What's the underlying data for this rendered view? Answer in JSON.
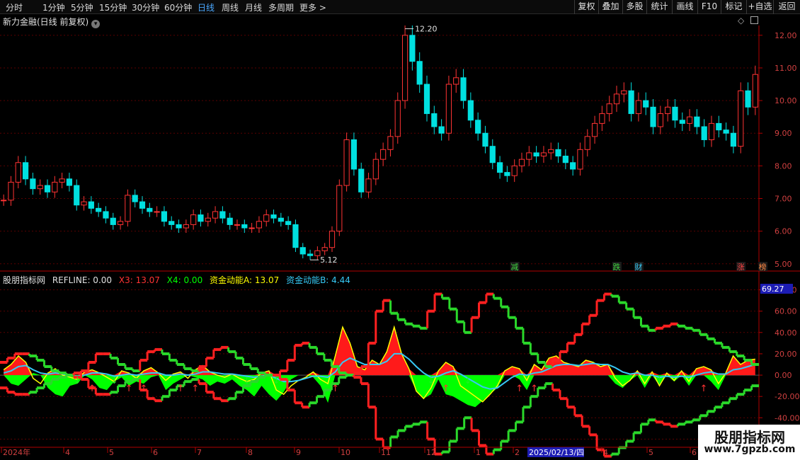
{
  "toolbar": {
    "timeframes": [
      "分时",
      "1分钟",
      "5分钟",
      "15分钟",
      "30分钟",
      "60分钟",
      "日线",
      "周线",
      "月线",
      "多周期",
      "更多 >"
    ],
    "active_timeframe": "日线",
    "buttons": [
      "复权",
      "叠加",
      "多股",
      "统计",
      "画线",
      "F10",
      "标记",
      "+自选",
      "返回"
    ]
  },
  "kline_title": "新力金融(日线 前复权)",
  "ind_title": {
    "name": "股朋指标网",
    "refline": "REFLINE: 0.00",
    "x3": "X3: 13.07",
    "x4": "X4: 0.00",
    "a": "资金动能A: 13.07",
    "b": "资金动能B: 4.44"
  },
  "logo": {
    "line1": "股朋指标网",
    "line2": "www.7gpzb.com"
  },
  "colors": {
    "up": "#ff3333",
    "down": "#00e0e0",
    "green": "#00ff00",
    "yellow": "#ffff00",
    "cyan": "#36c9f5",
    "axis": "#b00000"
  },
  "chart_data": [
    {
      "type": "candlestick",
      "title": "新力金融(日线 前复权)",
      "y_ticks": [
        5.0,
        6.0,
        7.0,
        8.0,
        9.0,
        10.0,
        11.0,
        12.0
      ],
      "ylim": [
        4.8,
        12.3
      ],
      "high_label": "12.20",
      "low_label": "5.12",
      "closes": [
        6.95,
        7.5,
        8.1,
        7.6,
        7.3,
        7.4,
        7.2,
        7.5,
        7.6,
        7.4,
        6.8,
        6.9,
        6.7,
        6.6,
        6.4,
        6.2,
        6.3,
        7.1,
        6.9,
        6.7,
        6.6,
        6.6,
        6.3,
        6.2,
        6.1,
        6.2,
        6.5,
        6.3,
        6.4,
        6.6,
        6.4,
        6.2,
        6.2,
        6.1,
        6.1,
        6.3,
        6.5,
        6.4,
        6.3,
        6.2,
        5.5,
        5.3,
        5.25,
        5.4,
        5.5,
        6.0,
        7.4,
        8.8,
        7.9,
        7.2,
        7.6,
        8.2,
        8.5,
        8.9,
        10.0,
        12.0,
        11.2,
        10.5,
        9.6,
        9.2,
        9.0,
        10.5,
        10.7,
        10.0,
        9.4,
        9.0,
        8.6,
        8.1,
        7.8,
        7.7,
        8.0,
        8.2,
        8.4,
        8.3,
        8.4,
        8.5,
        8.3,
        8.1,
        7.9,
        8.5,
        8.9,
        9.3,
        9.6,
        9.9,
        10.2,
        10.3,
        9.6,
        10.0,
        9.8,
        9.2,
        9.6,
        9.8,
        9.4,
        9.3,
        9.5,
        9.2,
        8.8,
        9.3,
        9.1,
        9.0,
        8.6,
        10.3,
        9.8,
        10.8
      ],
      "x_labels": [
        "2024年",
        "4",
        "5",
        "6",
        "7",
        "8",
        "9",
        "10",
        "11",
        "12",
        "1",
        "2",
        "4",
        "5",
        "6"
      ],
      "highlight_x_label": "2025/02/13/四",
      "event_markers": [
        {
          "label": "减",
          "color": "#3fd23f"
        },
        {
          "label": "跌",
          "color": "#3fd23f"
        },
        {
          "label": "财",
          "color": "#36c9f5"
        },
        {
          "label": "涨",
          "color": "#ff4444"
        },
        {
          "label": "榜",
          "color": "#ff8844"
        }
      ]
    },
    {
      "type": "line",
      "title": "股朋指标网",
      "y_ticks": [
        -60.0,
        -40.0,
        -20.0,
        0.0,
        20.0,
        40.0,
        60.0,
        80.0
      ],
      "ylim": [
        -65,
        85
      ],
      "current_value_label": "69.27",
      "series": [
        {
          "name": "X3",
          "values": [
            5,
            10,
            18,
            12,
            -3,
            -8,
            2,
            6,
            0,
            -2,
            -4,
            3,
            5,
            2,
            -2,
            -6,
            4,
            2,
            -3,
            4,
            7,
            2,
            -5,
            1,
            3,
            -3,
            5,
            9,
            3,
            0,
            -2,
            1,
            -3,
            -6,
            -4,
            2,
            4,
            -14,
            -18,
            -10,
            -5,
            -2,
            3,
            -4,
            -8,
            18,
            45,
            30,
            8,
            5,
            14,
            10,
            22,
            45,
            20,
            6,
            -15,
            -22,
            -12,
            4,
            12,
            8,
            -10,
            -15,
            -20,
            -25,
            -18,
            -10,
            4,
            8,
            6,
            -5,
            10,
            5,
            16,
            18,
            12,
            10,
            8,
            14,
            12,
            8,
            10,
            -3,
            -10,
            -5,
            4,
            -8,
            3,
            -10,
            2,
            -5,
            4,
            -6,
            6,
            8,
            5,
            -8,
            2,
            18,
            10,
            14,
            15
          ]
        },
        {
          "name": "X4",
          "values": [
            0,
            -8,
            -10,
            -4,
            2,
            0,
            -12,
            -18,
            -20,
            -10,
            -8,
            0,
            -4,
            -12,
            -14,
            -6,
            -2,
            -10,
            -6,
            -8,
            -2,
            0,
            -14,
            -8,
            -4,
            0,
            -2,
            -4,
            -10,
            -6,
            -8,
            -4,
            -10,
            -14,
            -20,
            -10,
            -18,
            -24,
            -16,
            -4,
            0,
            0,
            -2,
            -10,
            -26,
            0,
            0,
            0,
            0,
            0,
            0,
            0,
            0,
            0,
            0,
            0,
            -15,
            -22,
            -18,
            -4,
            -18,
            -20,
            -24,
            -28,
            -30,
            -24,
            -18,
            -12,
            0,
            0,
            -4,
            -14,
            0,
            0,
            0,
            0,
            0,
            0,
            0,
            0,
            0,
            0,
            0,
            -8,
            -12,
            -5,
            0,
            -12,
            0,
            -10,
            0,
            -6,
            0,
            -10,
            0,
            0,
            -6,
            -14,
            0,
            0,
            0,
            0,
            0
          ]
        },
        {
          "name": "资金动能A",
          "values": [
            5,
            10,
            18,
            12,
            -3,
            -8,
            2,
            6,
            0,
            -2,
            -4,
            3,
            5,
            2,
            -2,
            -6,
            4,
            2,
            -3,
            4,
            7,
            2,
            -5,
            1,
            3,
            -3,
            5,
            9,
            3,
            0,
            -2,
            1,
            -3,
            -6,
            -4,
            2,
            4,
            -14,
            -18,
            -10,
            -5,
            -2,
            3,
            -4,
            -8,
            18,
            45,
            30,
            8,
            5,
            14,
            10,
            22,
            45,
            20,
            6,
            -15,
            -22,
            -12,
            4,
            12,
            8,
            -10,
            -15,
            -20,
            -25,
            -18,
            -10,
            4,
            8,
            6,
            -5,
            10,
            5,
            16,
            18,
            12,
            10,
            8,
            14,
            12,
            8,
            10,
            -3,
            -10,
            -5,
            4,
            -8,
            3,
            -10,
            2,
            -5,
            4,
            -6,
            6,
            8,
            5,
            -8,
            2,
            18,
            10,
            14,
            15
          ]
        },
        {
          "name": "资金动能B",
          "values": [
            2,
            4,
            8,
            9,
            5,
            2,
            1,
            2,
            1,
            0,
            -1,
            0,
            2,
            2,
            1,
            -1,
            0,
            1,
            0,
            1,
            2,
            2,
            0,
            0,
            1,
            0,
            1,
            3,
            3,
            2,
            1,
            1,
            0,
            -1,
            -2,
            -1,
            0,
            -3,
            -6,
            -6,
            -5,
            -3,
            -1,
            -1,
            -2,
            3,
            12,
            16,
            13,
            10,
            10,
            10,
            13,
            20,
            20,
            15,
            8,
            2,
            -2,
            -1,
            2,
            4,
            1,
            -3,
            -7,
            -11,
            -13,
            -12,
            -7,
            -2,
            1,
            0,
            2,
            3,
            6,
            9,
            10,
            10,
            9,
            10,
            11,
            10,
            10,
            7,
            3,
            1,
            2,
            0,
            0,
            -2,
            -1,
            -2,
            -1,
            -2,
            0,
            2,
            3,
            1,
            1,
            5,
            6,
            8,
            10
          ]
        },
        {
          "name": "upper",
          "values": [
            12,
            16,
            20,
            20,
            18,
            14,
            8,
            4,
            2,
            0,
            -2,
            4,
            12,
            20,
            20,
            16,
            10,
            6,
            4,
            14,
            22,
            24,
            20,
            14,
            10,
            6,
            4,
            8,
            16,
            24,
            26,
            22,
            16,
            10,
            6,
            2,
            0,
            0,
            4,
            14,
            28,
            30,
            26,
            20,
            14,
            8,
            2,
            0,
            2,
            8,
            30,
            60,
            70,
            58,
            52,
            48,
            46,
            44,
            60,
            76,
            72,
            62,
            50,
            40,
            54,
            68,
            76,
            72,
            64,
            54,
            44,
            30,
            20,
            12,
            8,
            14,
            22,
            30,
            38,
            48,
            56,
            70,
            76,
            74,
            68,
            62,
            54,
            46,
            42,
            44,
            46,
            48,
            46,
            44,
            42,
            38,
            34,
            30,
            26,
            22,
            18,
            14,
            10
          ]
        },
        {
          "name": "lower",
          "values": [
            -12,
            -16,
            -18,
            -18,
            -16,
            -12,
            -8,
            -4,
            -2,
            0,
            2,
            -4,
            -12,
            -18,
            -18,
            -16,
            -10,
            -6,
            -4,
            -14,
            -22,
            -24,
            -20,
            -14,
            -10,
            -6,
            -4,
            -8,
            -16,
            -22,
            -24,
            -22,
            -16,
            -10,
            -6,
            -2,
            0,
            0,
            -4,
            -14,
            -26,
            -30,
            -26,
            -20,
            -14,
            -8,
            -2,
            0,
            -2,
            -8,
            -30,
            -60,
            -68,
            -58,
            -52,
            -48,
            -46,
            -44,
            -60,
            -74,
            -72,
            -62,
            -50,
            -40,
            -52,
            -66,
            -74,
            -70,
            -62,
            -52,
            -44,
            -30,
            -20,
            -12,
            -8,
            -14,
            -22,
            -30,
            -38,
            -48,
            -56,
            -70,
            -76,
            -74,
            -68,
            -62,
            -54,
            -46,
            -42,
            -44,
            -46,
            -48,
            -46,
            -44,
            -42,
            -38,
            -34,
            -30,
            -26,
            -22,
            -18,
            -14,
            -10
          ]
        }
      ]
    }
  ]
}
